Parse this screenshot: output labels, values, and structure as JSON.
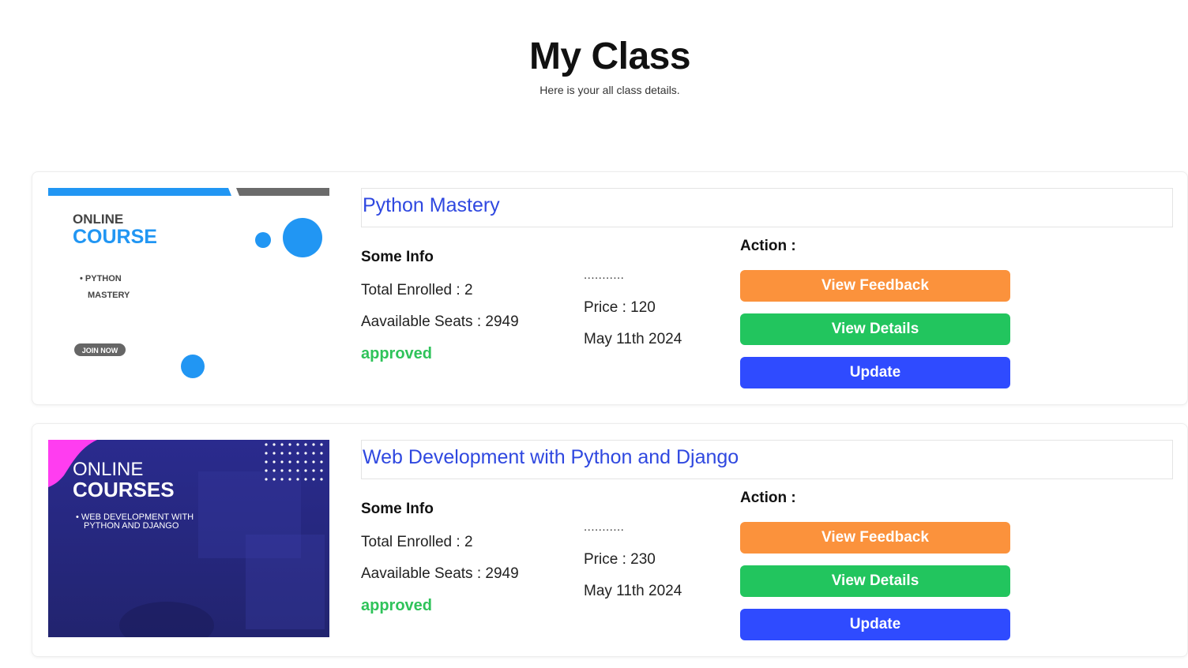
{
  "header": {
    "title": "My Class",
    "subtitle": "Here is your all class details."
  },
  "labels": {
    "some_info": "Some Info",
    "action": "Action :",
    "dots": "..........."
  },
  "buttons": {
    "view_feedback": "View Feedback",
    "view_details": "View Details",
    "update": "Update"
  },
  "classes": [
    {
      "title": "Python Mastery",
      "total_enrolled": "Total Enrolled : 2",
      "available_seats": "Aavailable Seats : 2949",
      "status": "approved",
      "price": "Price : 120",
      "date": "May 11th 2024",
      "thumbnail": {
        "line1": "ONLINE",
        "line2": "COURSE",
        "bullet1": "• PYTHON",
        "bullet2": "MASTERY",
        "cta": "JOIN NOW"
      }
    },
    {
      "title": "Web Development with Python and Django",
      "total_enrolled": "Total Enrolled : 2",
      "available_seats": "Aavailable Seats : 2949",
      "status": "approved",
      "price": "Price : 230",
      "date": "May 11th 2024",
      "thumbnail": {
        "line1": "ONLINE",
        "line2": "COURSES",
        "bullet1": "• WEB DEVELOPMENT WITH",
        "bullet2": "PYTHON AND DJANGO"
      }
    }
  ],
  "colors": {
    "title_blue": "#2f48e0",
    "approved_green": "#2fc35a",
    "feedback_orange": "#fb923c",
    "details_green": "#22c55e",
    "update_blue": "#2f4bff",
    "thumb1_accent": "#2196f3",
    "thumb2_bg": "#28298a",
    "thumb2_accent": "#ff3df0"
  }
}
